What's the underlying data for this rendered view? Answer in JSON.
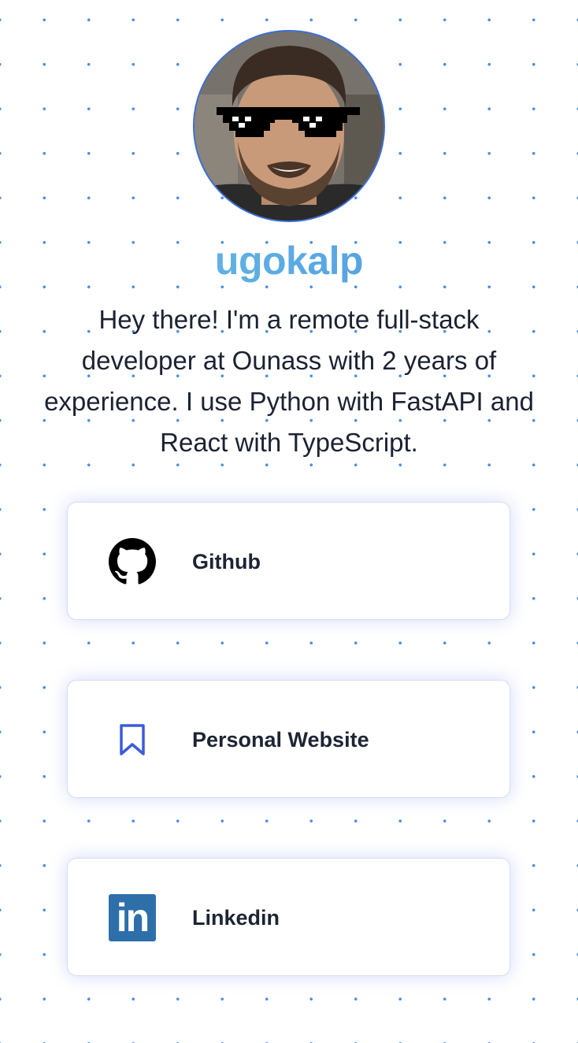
{
  "profile": {
    "avatar_icon": "avatar-photo",
    "username": "ugokalp",
    "bio": "Hey there! I'm a remote full-stack developer at Ounass with 2 years of experience. I use Python with FastAPI and React with TypeScript."
  },
  "links": [
    {
      "label": "Github",
      "icon": "github-icon"
    },
    {
      "label": "Personal Website",
      "icon": "bookmark-icon"
    },
    {
      "label": "Linkedin",
      "icon": "linkedin-icon",
      "icon_text": "in"
    }
  ],
  "colors": {
    "username_gradient_start": "#6cc6e6",
    "username_gradient_end": "#4b8fe0",
    "dot_pattern": "#4a90e2",
    "bookmark_icon": "#3b5bdb",
    "linkedin_brand": "#2e6faa",
    "text": "#1b2232"
  }
}
